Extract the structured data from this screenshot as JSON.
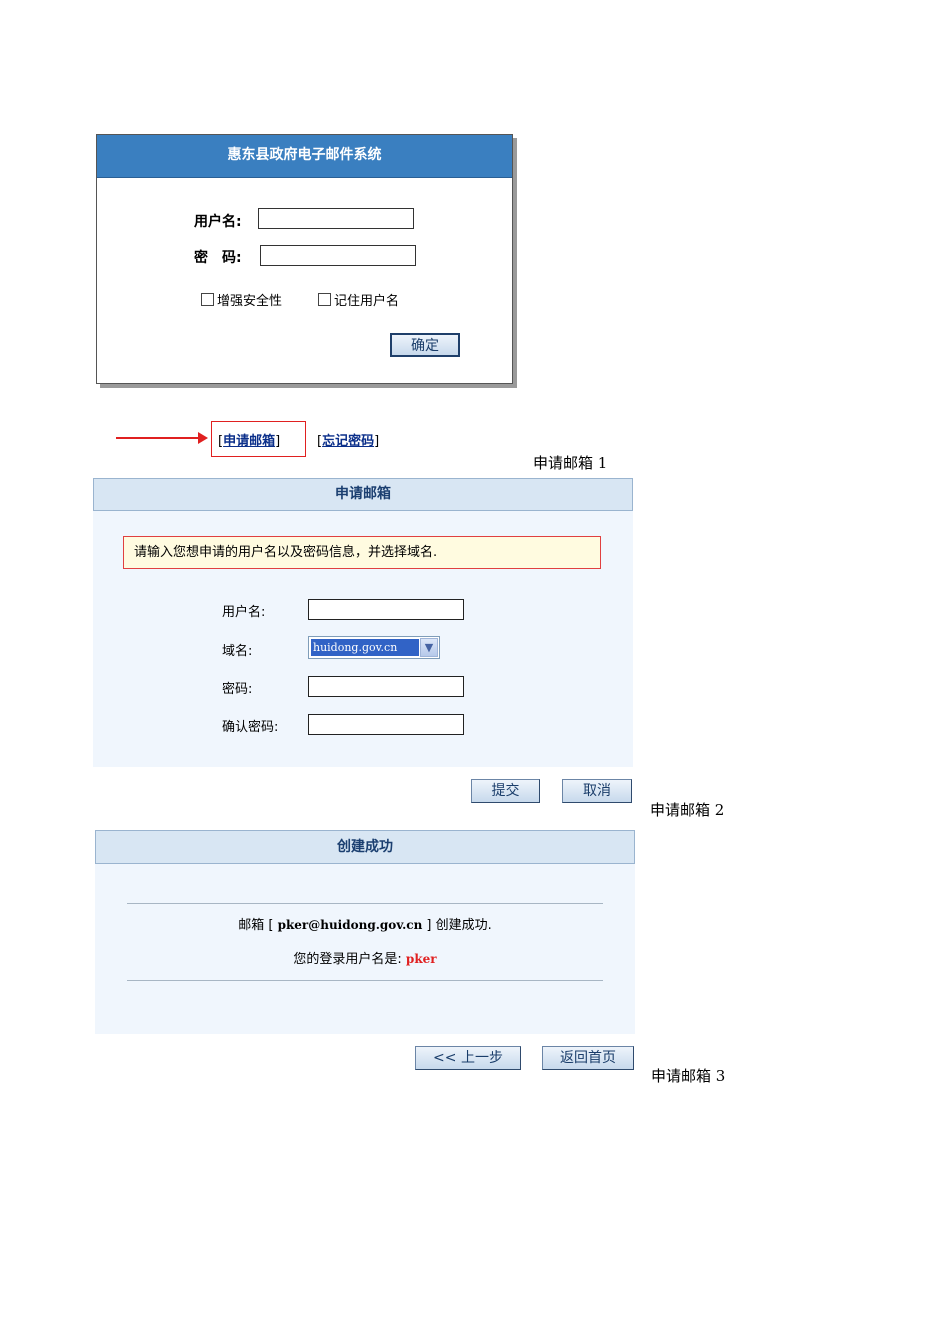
{
  "login": {
    "title": "惠东县政府电子邮件系统",
    "username_label": "用户名:",
    "password_label": "密　码:",
    "enhance_security_label": "增强安全性",
    "remember_username_label": "记住用户名",
    "confirm_button": "确定"
  },
  "links": {
    "apply_mailbox": "申请邮箱",
    "forgot_password": "忘记密码",
    "bracket_open": "[",
    "bracket_close": "]"
  },
  "captions": {
    "step1": "申请邮箱 1",
    "step2": "申请邮箱 2",
    "step3": "申请邮箱 3"
  },
  "apply": {
    "title": "申请邮箱",
    "notice": "请输入您想申请的用户名以及密码信息，并选择域名.",
    "username_label": "用户名:",
    "domain_label": "域名:",
    "domain_value": "huidong.gov.cn",
    "password_label": "密码:",
    "confirm_password_label": "确认密码:",
    "submit_button": "提交",
    "cancel_button": "取消"
  },
  "success": {
    "title": "创建成功",
    "mailbox_prefix": "邮箱 [ ",
    "mailbox_address": "pker@huidong.gov.cn",
    "mailbox_suffix": " ] 创建成功.",
    "login_name_prefix": "您的登录用户名是:",
    "login_name": "pker",
    "prev_button": "<< 上一步",
    "home_button": "返回首页"
  },
  "colors": {
    "login_header": "#3a7fc0",
    "panel_header": "#d8e6f3",
    "panel_body": "#f0f6fd",
    "highlight_red": "#e02020",
    "notice_bg": "#fffbe0"
  }
}
